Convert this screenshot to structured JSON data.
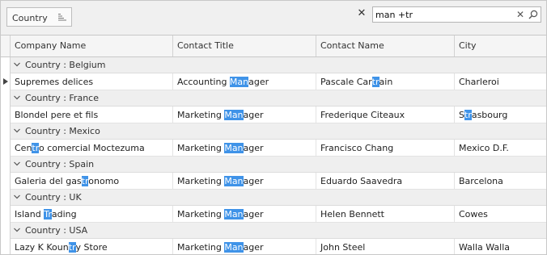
{
  "group_panel": {
    "group_by_label": "Country"
  },
  "search": {
    "value": "man +tr",
    "close_icon": "close-icon",
    "clear_icon": "clear-icon",
    "search_icon": "search-icon"
  },
  "columns": [
    "Company Name",
    "Contact Title",
    "Contact Name",
    "City"
  ],
  "group_label_prefix": "Country : ",
  "highlight_color": "#3f93e8",
  "groups": [
    {
      "label": "Country : Belgium",
      "row": {
        "company": [
          [
            "Supremes delices",
            false
          ]
        ],
        "title": [
          [
            "Accounting ",
            false
          ],
          [
            "Man",
            true
          ],
          [
            "ager",
            false
          ]
        ],
        "contact": [
          [
            "Pascale Car",
            false
          ],
          [
            "tr",
            true
          ],
          [
            "ain",
            false
          ]
        ],
        "city": [
          [
            "Charleroi",
            false
          ]
        ]
      }
    },
    {
      "label": "Country : France",
      "row": {
        "company": [
          [
            "Blondel pere et fils",
            false
          ]
        ],
        "title": [
          [
            "Marketing ",
            false
          ],
          [
            "Man",
            true
          ],
          [
            "ager",
            false
          ]
        ],
        "contact": [
          [
            "Frederique Citeaux",
            false
          ]
        ],
        "city": [
          [
            "S",
            false
          ],
          [
            "tr",
            true
          ],
          [
            "asbourg",
            false
          ]
        ]
      }
    },
    {
      "label": "Country : Mexico",
      "row": {
        "company": [
          [
            "Cen",
            false
          ],
          [
            "tr",
            true
          ],
          [
            "o comercial Moctezuma",
            false
          ]
        ],
        "title": [
          [
            "Marketing ",
            false
          ],
          [
            "Man",
            true
          ],
          [
            "ager",
            false
          ]
        ],
        "contact": [
          [
            "Francisco Chang",
            false
          ]
        ],
        "city": [
          [
            "Mexico D.F.",
            false
          ]
        ]
      }
    },
    {
      "label": "Country : Spain",
      "row": {
        "company": [
          [
            "Galeria del gas",
            false
          ],
          [
            "tr",
            true
          ],
          [
            "onomo",
            false
          ]
        ],
        "title": [
          [
            "Marketing ",
            false
          ],
          [
            "Man",
            true
          ],
          [
            "ager",
            false
          ]
        ],
        "contact": [
          [
            "Eduardo Saavedra",
            false
          ]
        ],
        "city": [
          [
            "Barcelona",
            false
          ]
        ]
      }
    },
    {
      "label": "Country : UK",
      "row": {
        "company": [
          [
            "Island ",
            false
          ],
          [
            "Tr",
            true
          ],
          [
            "ading",
            false
          ]
        ],
        "title": [
          [
            "Marketing ",
            false
          ],
          [
            "Man",
            true
          ],
          [
            "ager",
            false
          ]
        ],
        "contact": [
          [
            "Helen Bennett",
            false
          ]
        ],
        "city": [
          [
            "Cowes",
            false
          ]
        ]
      }
    },
    {
      "label": "Country : USA",
      "row": {
        "company": [
          [
            "Lazy K Koun",
            false
          ],
          [
            "tr",
            true
          ],
          [
            "y Store",
            false
          ]
        ],
        "title": [
          [
            "Marketing ",
            false
          ],
          [
            "Man",
            true
          ],
          [
            "ager",
            false
          ]
        ],
        "contact": [
          [
            "John Steel",
            false
          ]
        ],
        "city": [
          [
            "Walla Walla",
            false
          ]
        ]
      }
    }
  ]
}
